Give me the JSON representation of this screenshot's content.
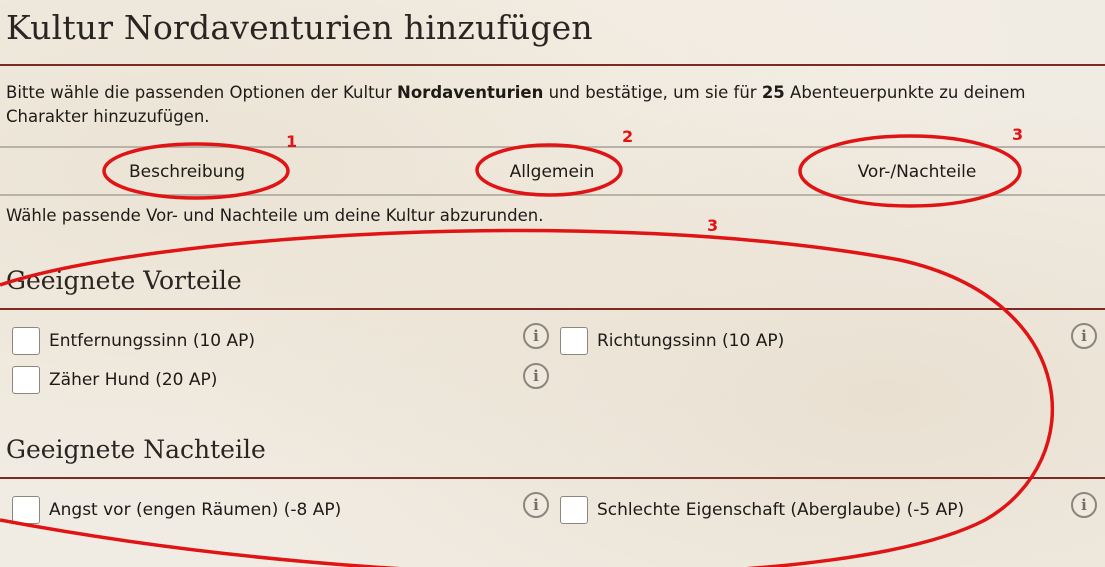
{
  "page": {
    "title": "Kultur Nordaventurien hinzufügen",
    "intro": {
      "part1": "Bitte wähle die passenden Optionen der Kultur ",
      "culture": "Nordaventurien",
      "part2": " und bestätige, um sie für ",
      "ap": "25",
      "part3": " Abenteuerpunkte zu deinem Charakter hinzuzufügen."
    },
    "tabs": [
      {
        "label": "Beschreibung"
      },
      {
        "label": "Allgemein"
      },
      {
        "label": "Vor-/Nachteile"
      }
    ],
    "hint": "Wähle passende Vor- und Nachteile um deine Kultur abzurunden."
  },
  "advantages": {
    "heading": "Geeignete Vorteile",
    "items": [
      {
        "label": "Entfernungssinn (10 AP)",
        "checked": false
      },
      {
        "label": "Richtungssinn (10 AP)",
        "checked": false
      },
      {
        "label": "Zäher Hund (20 AP)",
        "checked": false
      }
    ]
  },
  "disadvantages": {
    "heading": "Geeignete Nachteile",
    "items": [
      {
        "label": "Angst vor (engen Räumen) (-8 AP)",
        "checked": false
      },
      {
        "label": "Schlechte Eigenschaft (Aberglaube) (-5 AP)",
        "checked": false
      }
    ]
  },
  "icons": {
    "info": "info-icon",
    "info_glyph": "i"
  },
  "annotations": {
    "color": "#e01414",
    "labels": [
      "1",
      "2",
      "3",
      "3"
    ]
  },
  "colors": {
    "accent_rule": "#7e2a23",
    "divider": "#b8b2a8",
    "background": "#f1ece3"
  }
}
